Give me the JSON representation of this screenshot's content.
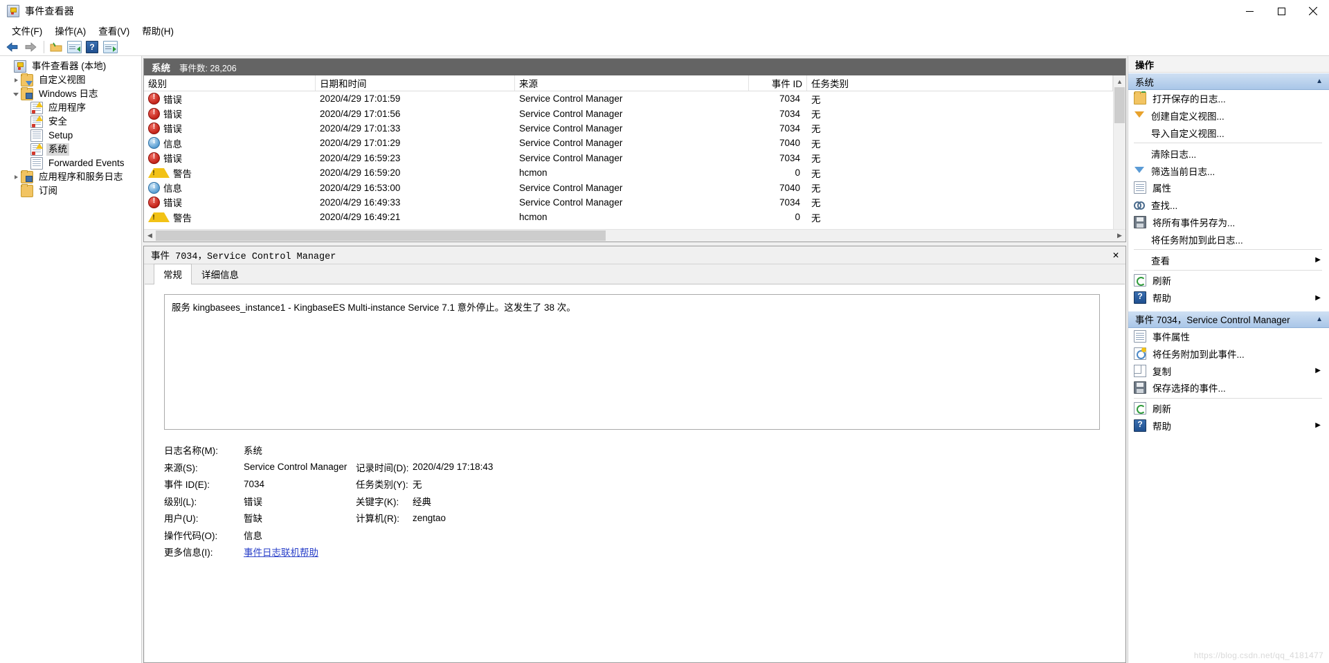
{
  "window": {
    "title": "事件查看器",
    "minimize_label": "最小化",
    "maximize_label": "最大化",
    "close_label": "关闭"
  },
  "menu": [
    {
      "label": "文件(F)",
      "plain": "文件",
      "accel": "F"
    },
    {
      "label": "操作(A)",
      "plain": "操作",
      "accel": "A"
    },
    {
      "label": "查看(V)",
      "plain": "查看",
      "accel": "V"
    },
    {
      "label": "帮助(H)",
      "plain": "帮助",
      "accel": "H"
    }
  ],
  "toolbar": {
    "back": "back-arrow-icon",
    "forward": "forward-arrow-icon",
    "open": "open-folder-icon",
    "show_pane_left": "show-console-tree-icon",
    "help": "help-icon",
    "show_pane_right": "show-action-pane-icon"
  },
  "tree": {
    "items": [
      {
        "label": "事件查看器 (本地)",
        "indent": 0,
        "icon": "event-viewer-icon",
        "twisty": "none",
        "selected": false
      },
      {
        "label": "自定义视图",
        "indent": 1,
        "icon": "custom-views-folder-icon",
        "twisty": "collapsed",
        "selected": false
      },
      {
        "label": "Windows 日志",
        "indent": 1,
        "icon": "windows-logs-folder-icon",
        "twisty": "expanded",
        "selected": false
      },
      {
        "label": "应用程序",
        "indent": 2,
        "icon": "log-warn-icon",
        "twisty": "none",
        "selected": false
      },
      {
        "label": "安全",
        "indent": 2,
        "icon": "log-warn-icon",
        "twisty": "none",
        "selected": false
      },
      {
        "label": "Setup",
        "indent": 2,
        "icon": "log-icon",
        "twisty": "none",
        "selected": false
      },
      {
        "label": "系统",
        "indent": 2,
        "icon": "log-warn-icon",
        "twisty": "none",
        "selected": true
      },
      {
        "label": "Forwarded Events",
        "indent": 2,
        "icon": "log-icon",
        "twisty": "none",
        "selected": false
      },
      {
        "label": "应用程序和服务日志",
        "indent": 1,
        "icon": "app-services-folder-icon",
        "twisty": "collapsed",
        "selected": false
      },
      {
        "label": "订阅",
        "indent": 1,
        "icon": "subscriptions-folder-icon",
        "twisty": "none",
        "selected": false
      }
    ]
  },
  "list": {
    "log_name": "系统",
    "count_label": "事件数: 28,206",
    "columns": {
      "level": "级别",
      "datetime": "日期和时间",
      "source": "来源",
      "event_id": "事件 ID",
      "task_category": "任务类别"
    },
    "rows": [
      {
        "level": "错误",
        "severity": "error",
        "datetime": "2020/4/29 17:01:59",
        "source": "Service Control Manager",
        "event_id": "7034",
        "task_category": "无"
      },
      {
        "level": "错误",
        "severity": "error",
        "datetime": "2020/4/29 17:01:56",
        "source": "Service Control Manager",
        "event_id": "7034",
        "task_category": "无"
      },
      {
        "level": "错误",
        "severity": "error",
        "datetime": "2020/4/29 17:01:33",
        "source": "Service Control Manager",
        "event_id": "7034",
        "task_category": "无"
      },
      {
        "level": "信息",
        "severity": "info",
        "datetime": "2020/4/29 17:01:29",
        "source": "Service Control Manager",
        "event_id": "7040",
        "task_category": "无"
      },
      {
        "level": "错误",
        "severity": "error",
        "datetime": "2020/4/29 16:59:23",
        "source": "Service Control Manager",
        "event_id": "7034",
        "task_category": "无"
      },
      {
        "level": "警告",
        "severity": "warning",
        "datetime": "2020/4/29 16:59:20",
        "source": "hcmon",
        "event_id": "0",
        "task_category": "无"
      },
      {
        "level": "信息",
        "severity": "info",
        "datetime": "2020/4/29 16:53:00",
        "source": "Service Control Manager",
        "event_id": "7040",
        "task_category": "无"
      },
      {
        "level": "错误",
        "severity": "error",
        "datetime": "2020/4/29 16:49:33",
        "source": "Service Control Manager",
        "event_id": "7034",
        "task_category": "无"
      },
      {
        "level": "警告",
        "severity": "warning",
        "datetime": "2020/4/29 16:49:21",
        "source": "hcmon",
        "event_id": "0",
        "task_category": "无"
      }
    ]
  },
  "detail": {
    "title": "事件 7034，Service Control Manager",
    "close_label": "✕",
    "tabs": [
      {
        "label": "常规",
        "active": true
      },
      {
        "label": "详细信息",
        "active": false
      }
    ],
    "message": "服务 kingbasees_instance1 - KingbaseES Multi-instance Service 7.1 意外停止。这发生了 38 次。",
    "fields": {
      "log_name_label": "日志名称(M):",
      "log_name_value": "系统",
      "source_label": "来源(S):",
      "source_value": "Service Control Manager",
      "logged_label": "记录时间(D):",
      "logged_value": "2020/4/29 17:18:43",
      "event_id_label": "事件 ID(E):",
      "event_id_value": "7034",
      "task_category_label": "任务类别(Y):",
      "task_category_value": "无",
      "level_label": "级别(L):",
      "level_value": "错误",
      "keywords_label": "关键字(K):",
      "keywords_value": "经典",
      "user_label": "用户(U):",
      "user_value": "暂缺",
      "computer_label": "计算机(R):",
      "computer_value": "zengtao",
      "opcode_label": "操作代码(O):",
      "opcode_value": "信息",
      "more_info_label": "更多信息(I):",
      "more_info_link": "事件日志联机帮助"
    }
  },
  "actions": {
    "header": "操作",
    "groups": [
      {
        "title": "系统",
        "collapse_icon": "caret-up-icon",
        "items": [
          {
            "label": "打开保存的日志...",
            "icon": "open-saved-log-icon",
            "submenu": false,
            "sep_after": false
          },
          {
            "label": "创建自定义视图...",
            "icon": "create-custom-view-icon",
            "submenu": false,
            "sep_after": false
          },
          {
            "label": "导入自定义视图...",
            "icon": "none",
            "submenu": false,
            "sep_after": true
          },
          {
            "label": "清除日志...",
            "icon": "none",
            "submenu": false,
            "sep_after": false
          },
          {
            "label": "筛选当前日志...",
            "icon": "filter-icon",
            "submenu": false,
            "sep_after": false
          },
          {
            "label": "属性",
            "icon": "properties-icon",
            "submenu": false,
            "sep_after": false
          },
          {
            "label": "查找...",
            "icon": "find-icon",
            "submenu": false,
            "sep_after": false
          },
          {
            "label": "将所有事件另存为...",
            "icon": "save-icon",
            "submenu": false,
            "sep_after": false
          },
          {
            "label": "将任务附加到此日志...",
            "icon": "none",
            "submenu": false,
            "sep_after": true
          },
          {
            "label": "查看",
            "icon": "none",
            "submenu": true,
            "sep_after": true
          },
          {
            "label": "刷新",
            "icon": "refresh-icon",
            "submenu": false,
            "sep_after": false
          },
          {
            "label": "帮助",
            "icon": "help-icon",
            "submenu": true,
            "sep_after": false
          }
        ]
      },
      {
        "title": "事件 7034，Service Control Manager",
        "collapse_icon": "caret-up-icon",
        "items": [
          {
            "label": "事件属性",
            "icon": "properties-icon",
            "submenu": false,
            "sep_after": false
          },
          {
            "label": "将任务附加到此事件...",
            "icon": "attach-task-icon",
            "submenu": false,
            "sep_after": false
          },
          {
            "label": "复制",
            "icon": "copy-icon",
            "submenu": true,
            "sep_after": false
          },
          {
            "label": "保存选择的事件...",
            "icon": "save-icon",
            "submenu": false,
            "sep_after": true
          },
          {
            "label": "刷新",
            "icon": "refresh-icon",
            "submenu": false,
            "sep_after": false
          },
          {
            "label": "帮助",
            "icon": "help-icon",
            "submenu": true,
            "sep_after": false
          }
        ]
      }
    ]
  },
  "watermark": "https://blog.csdn.net/qq_4181477"
}
